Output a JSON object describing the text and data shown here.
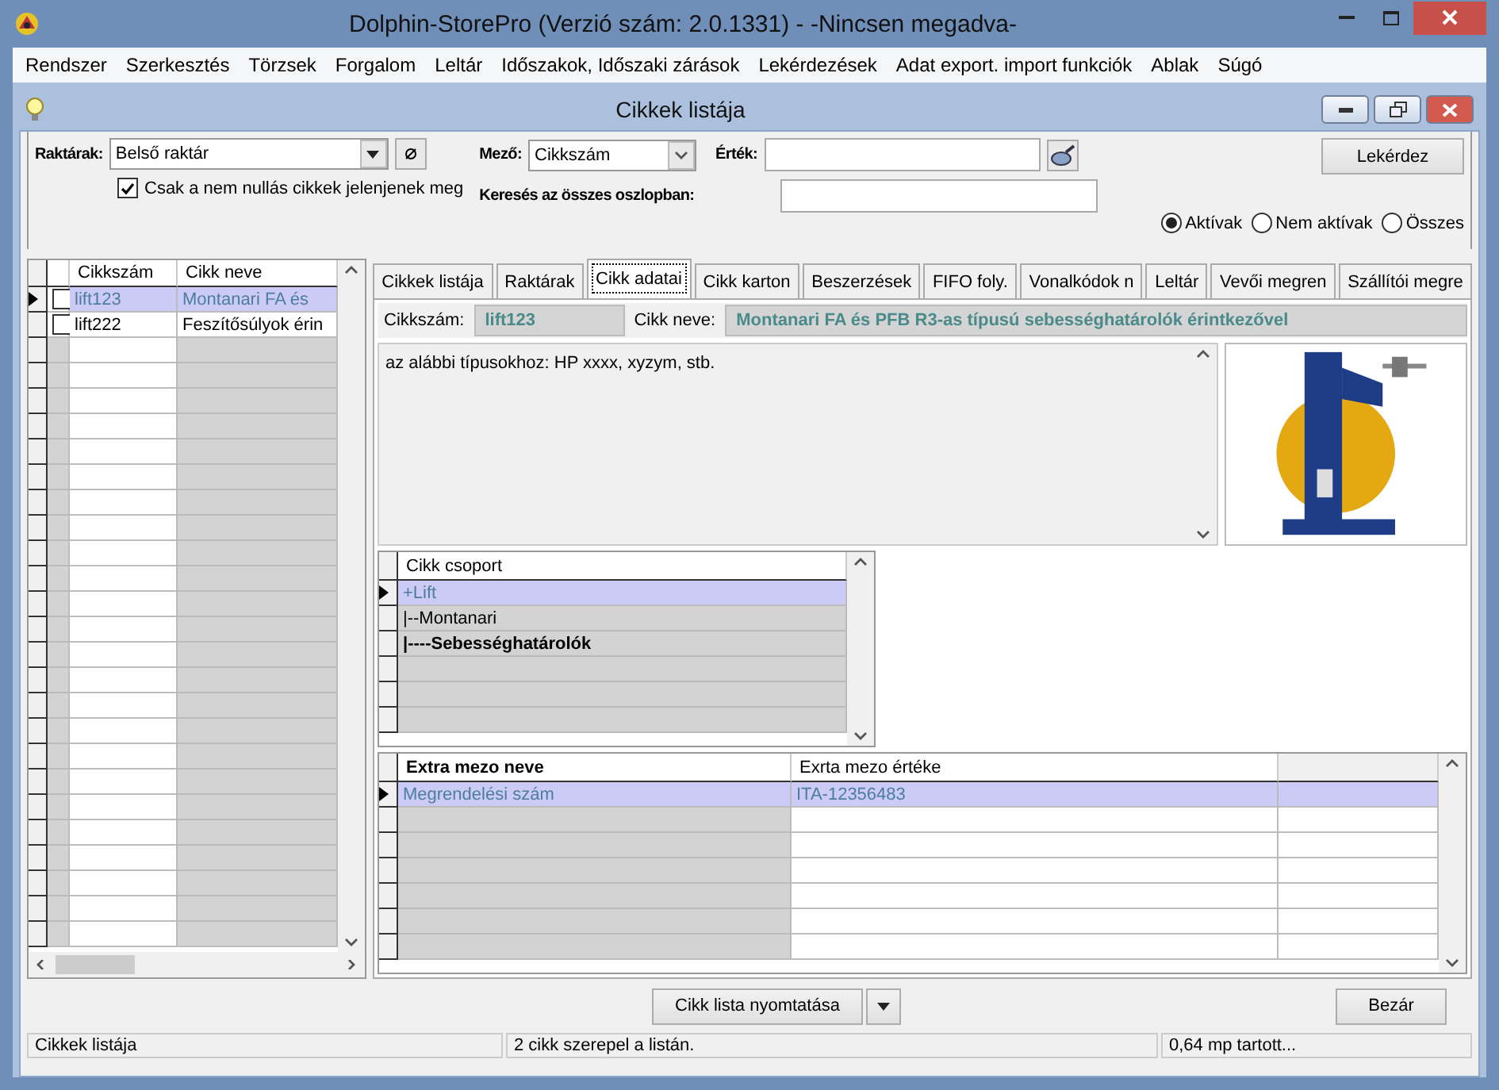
{
  "window": {
    "title": "Dolphin-StorePro  (Verzió szám: 2.0.1331) - -Nincsen megadva-"
  },
  "menu": [
    "Rendszer",
    "Szerkesztés",
    "Törzsek",
    "Forgalom",
    "Leltár",
    "Időszakok, Időszaki zárások",
    "Lekérdezések",
    "Adat export. import funkciók",
    "Ablak",
    "Súgó"
  ],
  "child_window": {
    "title": "Cikkek listája"
  },
  "filters": {
    "warehouse_label": "Raktárak:",
    "warehouse_value": "Belső raktár",
    "nonzero": {
      "label": "Csak a nem nullás cikkek jelenjenek meg",
      "checked": true
    },
    "field_label": "Mező:",
    "field_value": "Cikkszám",
    "value_label": "Érték:",
    "search_all_label": "Keresés az összes oszlopban:",
    "query_button": "Lekérdez",
    "status_radios": [
      {
        "label": "Aktívak",
        "selected": true
      },
      {
        "label": "Nem aktívak",
        "selected": false
      },
      {
        "label": "Összes",
        "selected": false
      }
    ]
  },
  "item_grid": {
    "columns": [
      "Cikkszám",
      "Cikk neve"
    ],
    "rows": [
      {
        "code": "lift123",
        "name": "Montanari FA és",
        "checked": false,
        "selected": true
      },
      {
        "code": "lift222",
        "name": "Feszítősúlyok érin",
        "checked": false,
        "selected": false
      }
    ]
  },
  "tabs": [
    {
      "label": "Cikkek listája",
      "selected": false
    },
    {
      "label": "Raktárak",
      "selected": false
    },
    {
      "label": "Cikk adatai",
      "selected": true
    },
    {
      "label": "Cikk karton",
      "selected": false
    },
    {
      "label": "Beszerzések",
      "selected": false
    },
    {
      "label": "FIFO foly.",
      "selected": false
    },
    {
      "label": "Vonalkódok n",
      "selected": false
    },
    {
      "label": "Leltár",
      "selected": false
    },
    {
      "label": "Vevői megren",
      "selected": false
    },
    {
      "label": "Szállítói megre",
      "selected": false
    }
  ],
  "details": {
    "code_label": "Cikkszám:",
    "code": "lift123",
    "name_label": "Cikk neve:",
    "name": "Montanari FA és PFB R3-as típusú sebességhatárolók érintkezővel",
    "description": "az alábbi típusokhoz: HP xxxx, xyzym, stb."
  },
  "group_tree": {
    "column": "Cikk csoport",
    "rows": [
      {
        "label": "+Lift",
        "selected": true,
        "bold": false
      },
      {
        "label": "|--Montanari",
        "selected": false,
        "bold": false
      },
      {
        "label": "|----Sebességhatárolók",
        "selected": false,
        "bold": true
      }
    ]
  },
  "extra_fields": {
    "columns": [
      "Extra mezo neve",
      "Exrta mezo értéke"
    ],
    "rows": [
      {
        "name": "Megrendelési szám",
        "value": "ITA-12356483",
        "selected": true
      }
    ]
  },
  "buttons": {
    "print": "Cikk lista nyomtatása",
    "close": "Bezár"
  },
  "status_bar": [
    "Cikkek listája",
    "2 cikk szerepel a listán.",
    "0,64 mp tartott..."
  ]
}
